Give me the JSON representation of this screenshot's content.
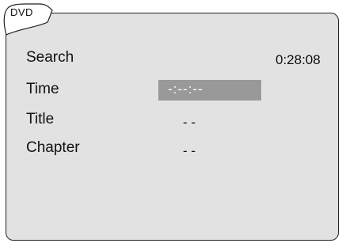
{
  "tab": {
    "label": "DVD"
  },
  "rows": [
    {
      "label": "Search",
      "value": "0:28:08"
    },
    {
      "label": "Time",
      "value": "-:--:--"
    },
    {
      "label": "Title",
      "value": "- -"
    },
    {
      "label": "Chapter",
      "value": "- -"
    }
  ],
  "colors": {
    "panel": "#e2e2e2",
    "highlight": "#999999",
    "text": "#111111"
  }
}
